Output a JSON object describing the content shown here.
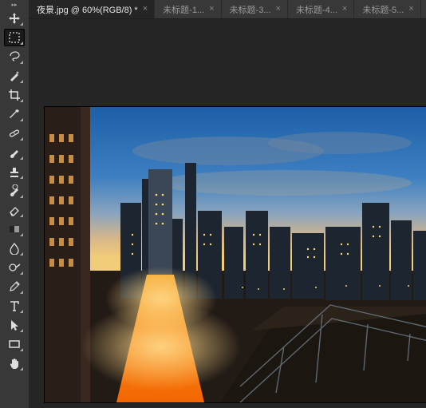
{
  "tabs": [
    {
      "label": "夜景.jpg @ 60%(RGB/8) *",
      "active": true
    },
    {
      "label": "未标题-1...",
      "active": false
    },
    {
      "label": "未标题-3...",
      "active": false
    },
    {
      "label": "未标题-4...",
      "active": false
    },
    {
      "label": "未标题-5...",
      "active": false
    }
  ],
  "tools": [
    {
      "name": "move-tool",
      "icon": "move",
      "sub": true
    },
    {
      "name": "marquee-tool",
      "icon": "marquee",
      "sub": true,
      "selected": true
    },
    {
      "name": "lasso-tool",
      "icon": "lasso",
      "sub": true
    },
    {
      "name": "magic-wand-tool",
      "icon": "wand",
      "sub": true
    },
    {
      "name": "crop-tool",
      "icon": "crop",
      "sub": true
    },
    {
      "name": "eyedropper-tool",
      "icon": "eyedrop",
      "sub": true
    },
    {
      "name": "healing-tool",
      "icon": "bandage",
      "sub": true
    },
    {
      "name": "brush-tool",
      "icon": "brush",
      "sub": true
    },
    {
      "name": "stamp-tool",
      "icon": "stamp",
      "sub": true
    },
    {
      "name": "history-brush-tool",
      "icon": "history",
      "sub": true
    },
    {
      "name": "eraser-tool",
      "icon": "eraser",
      "sub": true
    },
    {
      "name": "gradient-tool",
      "icon": "gradient",
      "sub": true
    },
    {
      "name": "blur-tool",
      "icon": "blur",
      "sub": true
    },
    {
      "name": "dodge-tool",
      "icon": "dodge",
      "sub": true
    },
    {
      "name": "pen-tool",
      "icon": "pen",
      "sub": true
    },
    {
      "name": "type-tool",
      "icon": "type",
      "sub": true
    },
    {
      "name": "path-select-tool",
      "icon": "arrow",
      "sub": true
    },
    {
      "name": "shape-tool",
      "icon": "rect",
      "sub": true
    },
    {
      "name": "hand-tool",
      "icon": "hand",
      "sub": true
    }
  ],
  "image": {
    "description": "City skyline at dusk with orange street lights and blue sky"
  }
}
